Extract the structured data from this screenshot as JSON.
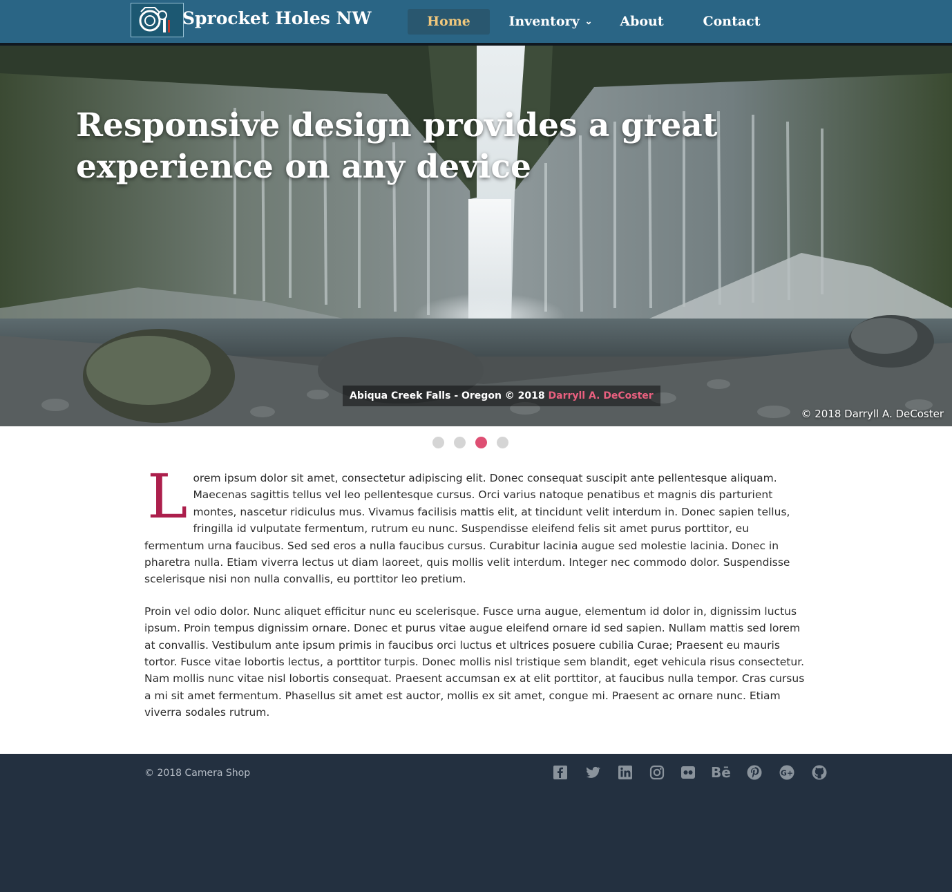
{
  "nav": {
    "brand": "Sprocket Holes NW",
    "items": [
      {
        "label": "Home",
        "active": true
      },
      {
        "label": "Inventory",
        "dropdown": true
      },
      {
        "label": "About"
      },
      {
        "label": "Contact"
      }
    ],
    "chevron_icon": "chevron-down-icon"
  },
  "hero": {
    "title": "Responsive design provides a great experience on any device",
    "caption_text": "Abiqua Creek Falls - Oregon © 2018",
    "caption_credit": "Darryll A. DeCoster",
    "image_copyright": "© 2018 Darryll A. DeCoster"
  },
  "carousel": {
    "slide_count": 4,
    "active_slide": 3
  },
  "content": {
    "dropcap": "L",
    "p1_rest": "orem ipsum dolor sit amet, consectetur adipiscing elit. Donec consequat suscipit ante pellentesque aliquam. Maecenas sagittis tellus vel leo pellentesque cursus. Orci varius natoque penatibus et magnis dis parturient montes, nascetur ridiculus mus. Vivamus facilisis mattis elit, at tincidunt velit interdum in. Donec sapien tellus, fringilla id vulputate fermentum, rutrum eu nunc. Suspendisse eleifend felis sit amet purus porttitor, eu fermentum urna faucibus. Sed sed eros a nulla faucibus cursus. Curabitur lacinia augue sed molestie lacinia. Donec in pharetra nulla. Etiam viverra lectus ut diam laoreet, quis mollis velit interdum. Integer nec commodo dolor. Suspendisse scelerisque nisi non nulla convallis, eu porttitor leo pretium.",
    "p2": "Proin vel odio dolor. Nunc aliquet efficitur nunc eu scelerisque. Fusce urna augue, elementum id dolor in, dignissim luctus ipsum. Proin tempus dignissim ornare. Donec et purus vitae augue eleifend ornare id sed sapien. Nullam mattis sed lorem at convallis. Vestibulum ante ipsum primis in faucibus orci luctus et ultrices posuere cubilia Curae; Praesent eu mauris tortor. Fusce vitae lobortis lectus, a porttitor turpis. Donec mollis nisl tristique sem blandit, eget vehicula risus consectetur. Nam mollis nunc vitae nisl lobortis consequat. Praesent accumsan ex at elit porttitor, at faucibus nulla tempor. Cras cursus a mi sit amet fermentum. Phasellus sit amet est auctor, mollis ex sit amet, congue mi. Praesent ac ornare nunc. Etiam viverra sodales rutrum."
  },
  "footer": {
    "copyright": "2018 Camera Shop",
    "copyright_icon": "copyright-icon",
    "social": [
      {
        "icon": "facebook-icon"
      },
      {
        "icon": "twitter-icon"
      },
      {
        "icon": "linkedin-icon"
      },
      {
        "icon": "instagram-icon"
      },
      {
        "icon": "flickr-icon"
      },
      {
        "icon": "behance-icon",
        "glyph": "Bē"
      },
      {
        "icon": "pinterest-icon"
      },
      {
        "icon": "google-plus-icon"
      },
      {
        "icon": "github-icon"
      }
    ]
  },
  "colors": {
    "nav_bg": "#2a6585",
    "nav_active_text": "#f0c77c",
    "accent": "#de4f73",
    "dropcap": "#ac1f4c",
    "footer_bg": "#233040",
    "footer_text": "#b7bec7"
  }
}
